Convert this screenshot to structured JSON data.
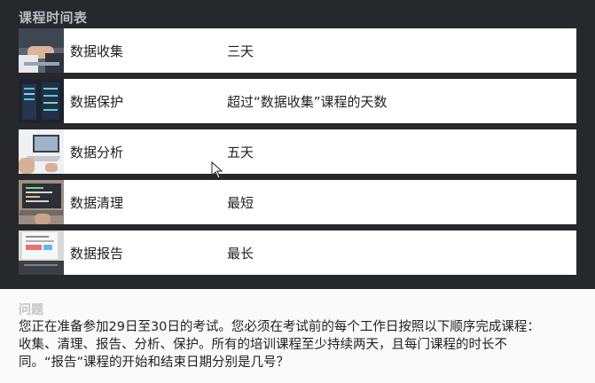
{
  "schedule": {
    "title": "课程时间表",
    "courses": [
      {
        "name": "数据收集",
        "duration": "三天",
        "thumb_icon": "handshake-photo-icon"
      },
      {
        "name": "数据保护",
        "duration": "超过“数据收集”课程的天数",
        "thumb_icon": "server-room-photo-icon"
      },
      {
        "name": "数据分析",
        "duration": "五天",
        "thumb_icon": "laptop-photo-icon"
      },
      {
        "name": "数据清理",
        "duration": "最短",
        "thumb_icon": "code-laptop-photo-icon"
      },
      {
        "name": "数据报告",
        "duration": "最长",
        "thumb_icon": "report-documents-photo-icon"
      }
    ]
  },
  "question": {
    "title": "问题",
    "lines": [
      "您正在准备参加29日至30日的考试。您必须在考试前的每个工作日按照以下顺序完成课程：",
      "收集、清理、报告、分析、保护。所有的培训课程至少持续两天，且每门课程的时长不",
      "同。“报告”课程的开始和结束日期分别是几号？"
    ]
  },
  "colors": {
    "panel_bg": "#26282c",
    "row_bg": "#ffffff",
    "title_gray": "#b8bcc4"
  }
}
